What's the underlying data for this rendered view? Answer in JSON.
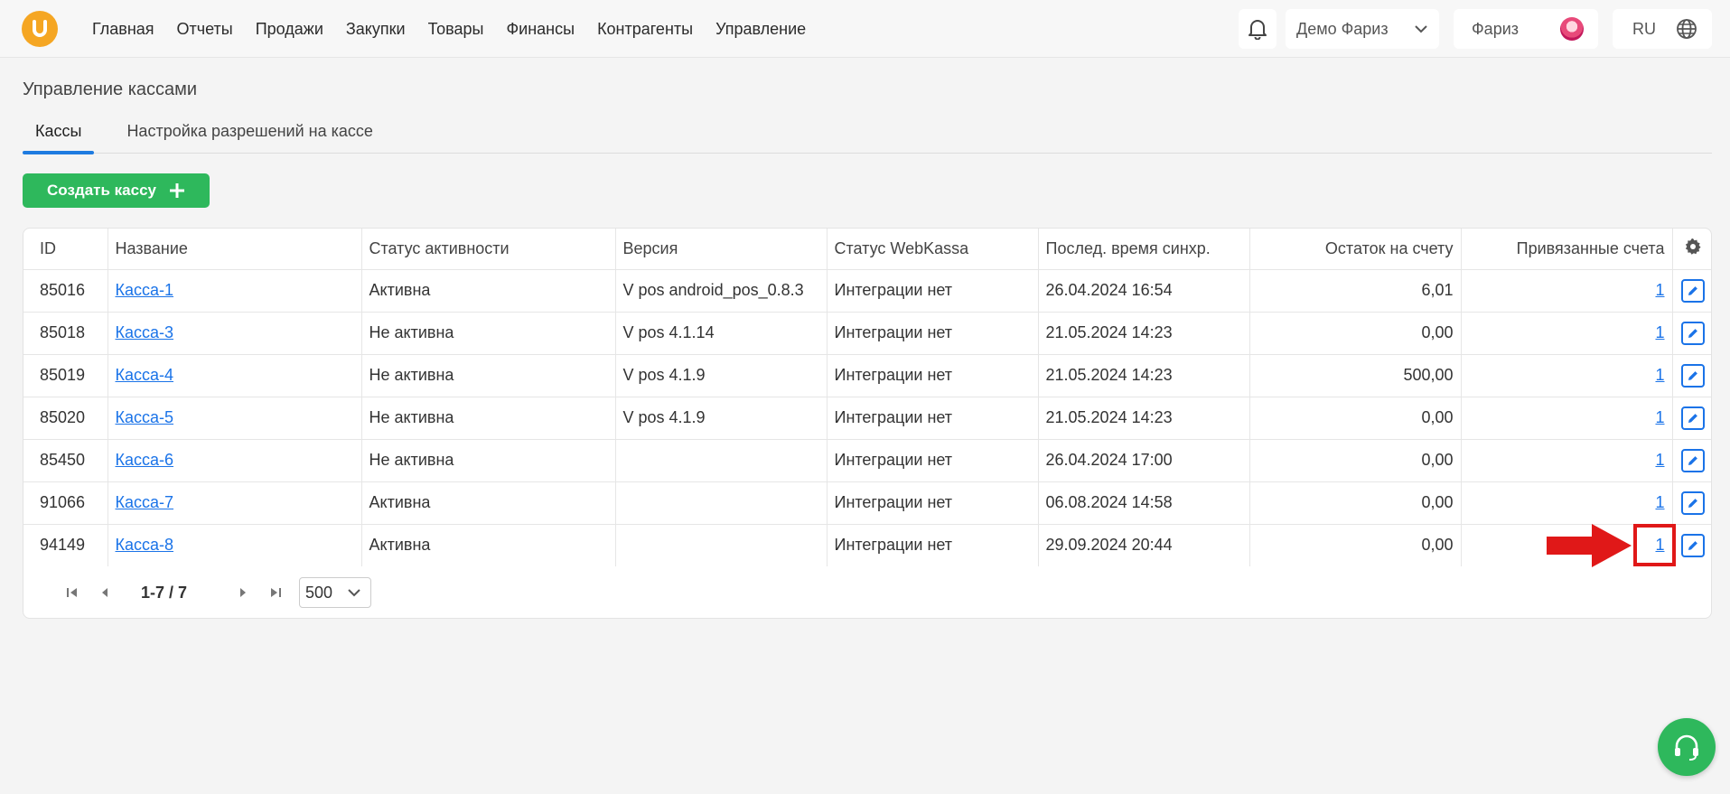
{
  "nav": {
    "items": [
      "Главная",
      "Отчеты",
      "Продажи",
      "Закупки",
      "Товары",
      "Финансы",
      "Контрагенты",
      "Управление"
    ]
  },
  "header": {
    "company": "Демо Фариз",
    "user": "Фариз",
    "lang": "RU"
  },
  "page": {
    "title": "Управление кассами",
    "tabs": [
      "Кассы",
      "Настройка разрешений на кассе"
    ],
    "create_button": "Создать кассу"
  },
  "table": {
    "columns": [
      "ID",
      "Название",
      "Статус активности",
      "Версия",
      "Статус WebKassa",
      "Послед. время синхр.",
      "Остаток на счету",
      "Привязанные счета"
    ],
    "rows": [
      {
        "id": "85016",
        "name": "Касса-1",
        "status": "Активна",
        "version": "V pos android_pos_0.8.3",
        "webkassa": "Интеграции нет",
        "sync": "26.04.2024 16:54",
        "balance": "6,01",
        "accounts": "1"
      },
      {
        "id": "85018",
        "name": "Касса-3",
        "status": "Не активна",
        "version": "V pos 4.1.14",
        "webkassa": "Интеграции нет",
        "sync": "21.05.2024 14:23",
        "balance": "0,00",
        "accounts": "1"
      },
      {
        "id": "85019",
        "name": "Касса-4",
        "status": "Не активна",
        "version": "V pos 4.1.9",
        "webkassa": "Интеграции нет",
        "sync": "21.05.2024 14:23",
        "balance": "500,00",
        "accounts": "1"
      },
      {
        "id": "85020",
        "name": "Касса-5",
        "status": "Не активна",
        "version": "V pos 4.1.9",
        "webkassa": "Интеграции нет",
        "sync": "21.05.2024 14:23",
        "balance": "0,00",
        "accounts": "1"
      },
      {
        "id": "85450",
        "name": "Касса-6",
        "status": "Не активна",
        "version": "",
        "webkassa": "Интеграции нет",
        "sync": "26.04.2024 17:00",
        "balance": "0,00",
        "accounts": "1"
      },
      {
        "id": "91066",
        "name": "Касса-7",
        "status": "Активна",
        "version": "",
        "webkassa": "Интеграции нет",
        "sync": "06.08.2024 14:58",
        "balance": "0,00",
        "accounts": "1"
      },
      {
        "id": "94149",
        "name": "Касса-8",
        "status": "Активна",
        "version": "",
        "webkassa": "Интеграции нет",
        "sync": "29.09.2024 20:44",
        "balance": "0,00",
        "accounts": "1"
      }
    ]
  },
  "pagination": {
    "range": "1-7 / 7",
    "page_size": "500"
  },
  "colors": {
    "accent": "#1e7be0",
    "create": "#2eb85c",
    "link": "#1a73e8",
    "annotation": "#e01818"
  }
}
